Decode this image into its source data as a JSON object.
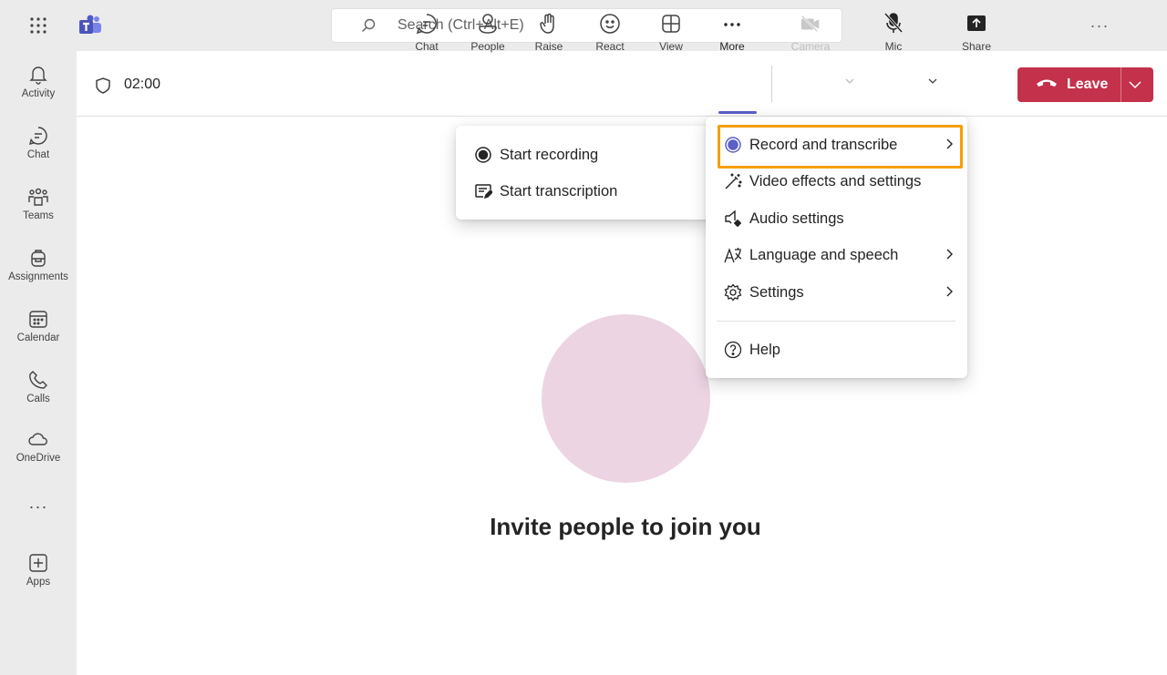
{
  "topbar": {
    "search_placeholder": "Search (Ctrl+Alt+E)",
    "more_label": "···"
  },
  "rail": {
    "items": [
      {
        "label": "Activity",
        "icon": "bell-icon"
      },
      {
        "label": "Chat",
        "icon": "chat-icon"
      },
      {
        "label": "Teams",
        "icon": "teams-icon"
      },
      {
        "label": "Assignments",
        "icon": "backpack-icon"
      },
      {
        "label": "Calendar",
        "icon": "calendar-icon"
      },
      {
        "label": "Calls",
        "icon": "phone-icon"
      },
      {
        "label": "OneDrive",
        "icon": "cloud-icon"
      }
    ],
    "more_label": "···",
    "apps_label": "Apps"
  },
  "meeting": {
    "timer": "02:00",
    "toolbar": {
      "chat": "Chat",
      "people": "People",
      "raise": "Raise",
      "react": "React",
      "view": "View",
      "more": "More",
      "camera": "Camera",
      "mic": "Mic",
      "share": "Share",
      "leave": "Leave"
    },
    "invite_text": "Invite people to join you"
  },
  "more_menu": {
    "items": [
      {
        "label": "Record and transcribe",
        "icon": "record-icon",
        "has_submenu": true
      },
      {
        "label": "Video effects and settings",
        "icon": "magic-wand-icon",
        "has_submenu": false
      },
      {
        "label": "Audio settings",
        "icon": "speaker-settings-icon",
        "has_submenu": false
      },
      {
        "label": "Language and speech",
        "icon": "language-icon",
        "has_submenu": true
      },
      {
        "label": "Settings",
        "icon": "gear-icon",
        "has_submenu": true
      },
      {
        "label": "Help",
        "icon": "help-icon",
        "has_submenu": false
      }
    ]
  },
  "record_submenu": {
    "items": [
      {
        "label": "Start recording",
        "icon": "record-icon"
      },
      {
        "label": "Start transcription",
        "icon": "transcript-icon"
      }
    ]
  },
  "colors": {
    "accent": "#5b5fc7",
    "leave": "#c4314b",
    "highlight": "#f5a000",
    "avatar": "#ecd4e3"
  }
}
